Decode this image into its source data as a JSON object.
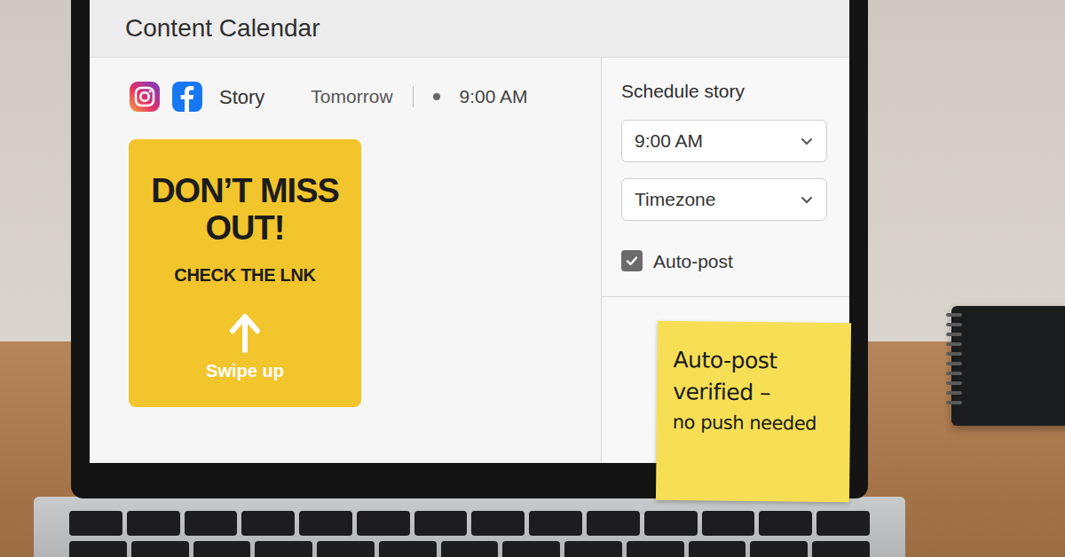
{
  "window": {
    "title": "Content Calendar"
  },
  "post": {
    "type": "Story",
    "day": "Tomorrow",
    "time": "9:00 AM"
  },
  "preview": {
    "headline": "DON’T MISS OUT!",
    "subline": "CHECK THE LNK",
    "cta": "Swipe up"
  },
  "schedule": {
    "title": "Schedule story",
    "time": "9:00 AM",
    "timezone": "Timezone",
    "auto_post": {
      "label": "Auto-post",
      "checked": true
    }
  },
  "sticky_note": {
    "lines": [
      "Auto-post",
      "verified –",
      "no push needed"
    ]
  }
}
